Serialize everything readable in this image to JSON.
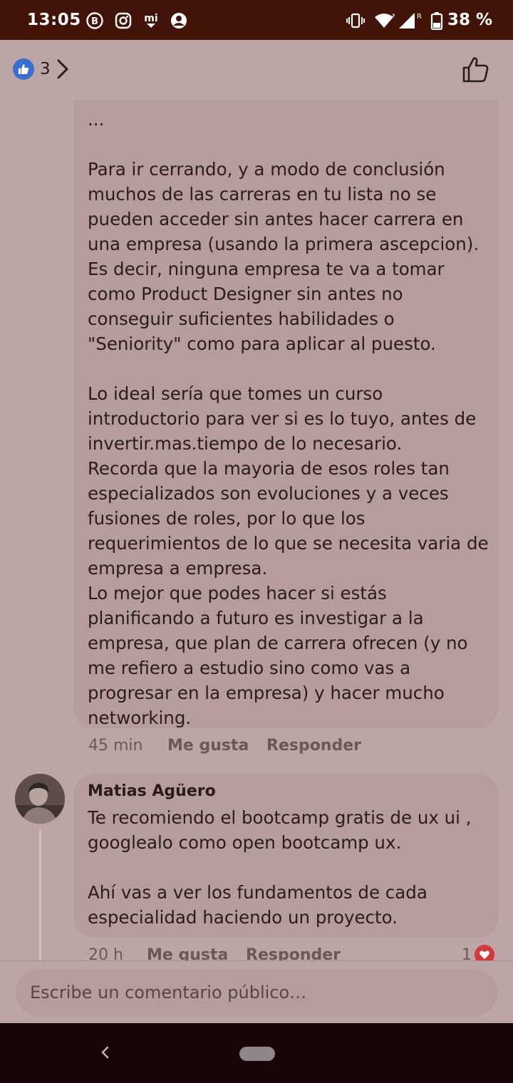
{
  "status_bar": {
    "time": "13:05",
    "battery": "38 %",
    "icons": [
      "b-circle-icon",
      "instagram-icon",
      "mi-icon",
      "person-alert-icon",
      "vibrate-icon",
      "wifi-icon",
      "signal-icon",
      "battery-icon"
    ]
  },
  "header": {
    "reaction_count": "3",
    "reaction_icon": "thumbs-up-badge-icon",
    "like_icon": "thumbs-up-outline-icon"
  },
  "comment1": {
    "text": "...\n\nPara ir cerrando, y a modo de conclusión muchos de las carreras en tu lista no se pueden acceder sin antes hacer carrera en una empresa (usando la primera ascepcion). Es decir, ninguna empresa te va a tomar como Product Designer sin antes no conseguir suficientes habilidades o \"Seniority\" como para aplicar al puesto.\n\nLo ideal sería que tomes un curso introductorio para ver si es lo tuyo, antes de invertir.mas.tiempo de lo necesario.\nRecorda que la mayoria de esos roles tan especializados son evoluciones y a veces fusiones de roles, por lo que los requerimientos de lo que se necesita varia de empresa a empresa.\nLo mejor que podes hacer si estás planificando a futuro es investigar a la empresa, que plan de carrera ofrecen (y no me refiero a estudio sino como vas a progresar en la empresa) y hacer mucho networking.",
    "time": "45 min",
    "like_label": "Me gusta",
    "reply_label": "Responder"
  },
  "comment2": {
    "author": "Matias Agüero",
    "text": "Te recomiendo el bootcamp gratis de ux ui , googlealo como open bootcamp ux.\n\nAhí vas a ver los fundamentos de cada especialidad haciendo un proyecto.",
    "time": "20 h",
    "like_label": "Me gusta",
    "reply_label": "Responder",
    "reaction_count": "1",
    "reaction_icon": "heart-icon"
  },
  "composer": {
    "placeholder": "Escribe un comentario público…"
  },
  "colors": {
    "overlay_bg": "#bda4a6",
    "bubble_bg": "#b79c9e",
    "status_bar": "#421407",
    "nav_bar": "#180507",
    "like_blue": "#3a6fd0",
    "heart_red": "#d23a3e"
  }
}
